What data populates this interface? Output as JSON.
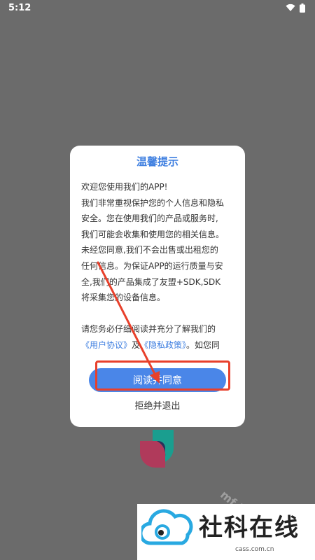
{
  "status_bar": {
    "time": "5:12"
  },
  "dialog": {
    "title": "温馨提示",
    "body_lines": [
      "欢迎您使用我们的APP!",
      "我们非常重视保护您的个人信息和隐私",
      "安全。您在使用我们的产品或服务时,",
      "我们可能会收集和使用您的相关信息。",
      "未经您同意,我们不会出售或出租您的",
      "任何信息。为保证APP的运行质量与安",
      "全,我们的产品集成了友盟+SDK,SDK",
      "将采集您的设备信息。"
    ],
    "notice_prefix": "请您务必仔细阅读并充分了解我们的",
    "link_user_agreement": "《用户协议》",
    "link_joiner": "及",
    "link_privacy_policy": "《隐私政策》",
    "notice_suffix": "。如您同",
    "agree_label": "阅读并同意",
    "refuse_label": "拒绝并退出"
  },
  "watermark": {
    "title": "社科在线",
    "domain": "cass.com.cn",
    "faint_text": "mf 魔趣"
  },
  "colors": {
    "background": "#6b6b6b",
    "accent": "#3f7fe0",
    "button": "#4a86e8",
    "annotation": "#e8402b"
  }
}
